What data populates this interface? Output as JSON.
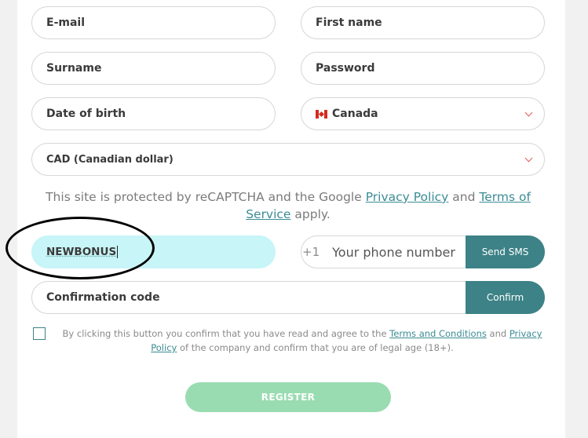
{
  "form": {
    "email_placeholder": "E-mail",
    "first_name_placeholder": "First name",
    "surname_placeholder": "Surname",
    "password_placeholder": "Password",
    "dob_placeholder": "Date of birth",
    "country_value": "Canada",
    "currency_value": "CAD (Canadian dollar)",
    "promo_value": "NEWBONUS",
    "phone_prefix": "+1",
    "phone_placeholder": "Your phone number",
    "send_sms_label": "Send SMS",
    "confirmation_placeholder": "Confirmation code",
    "confirm_label": "Confirm",
    "register_label": "REGISTER"
  },
  "recaptcha": {
    "prefix": "This site is protected by reCAPTCHA and the Google",
    "privacy_link": "Privacy Policy",
    "and": "and",
    "terms_link": "Terms of Service",
    "suffix": "apply."
  },
  "agreement": {
    "text_1": "By clicking this button you confirm that you have read and agree to the",
    "terms_link": "Terms and Conditions",
    "and": "and",
    "privacy_link": "Privacy Policy",
    "text_2": "of the company and confirm that you are of legal age (18+).",
    "checked": false
  },
  "colors": {
    "accent": "#3c8287",
    "link": "#3b8c94",
    "promo_bg": "#c8f5f7",
    "register_bg": "#99dcb1"
  }
}
